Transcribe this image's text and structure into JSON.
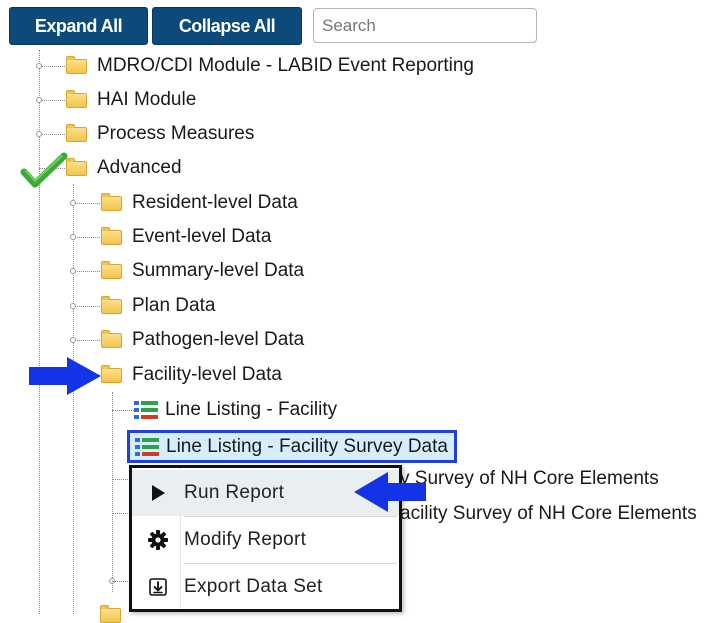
{
  "toolbar": {
    "expand_all": "Expand All",
    "collapse_all": "Collapse All",
    "search_placeholder": "Search"
  },
  "tree": {
    "top_items": [
      "MDRO/CDI Module - LABID Event Reporting",
      "HAI Module",
      "Process Measures",
      "Advanced"
    ],
    "advanced_children": [
      "Resident-level Data",
      "Event-level Data",
      "Summary-level Data",
      "Plan Data",
      "Pathogen-level Data",
      "Facility-level Data"
    ],
    "facility_children": [
      "Line Listing - Facility",
      "Line Listing - Facility Survey Data"
    ],
    "partially_hidden": [
      "y Survey of NH Core Elements",
      "acility Survey of NH Core Elements"
    ]
  },
  "context_menu": {
    "items": [
      {
        "label": "Run Report",
        "icon": "play-icon"
      },
      {
        "label": "Modify Report",
        "icon": "gear-icon"
      },
      {
        "label": "Export Data Set",
        "icon": "export-icon"
      }
    ]
  },
  "colors": {
    "button_bg": "#0b4a7a",
    "selection_border": "#1f3fe0",
    "selection_bg": "#d6eefc",
    "arrow_blue": "#1533e6",
    "check_green": "#3aa936"
  }
}
